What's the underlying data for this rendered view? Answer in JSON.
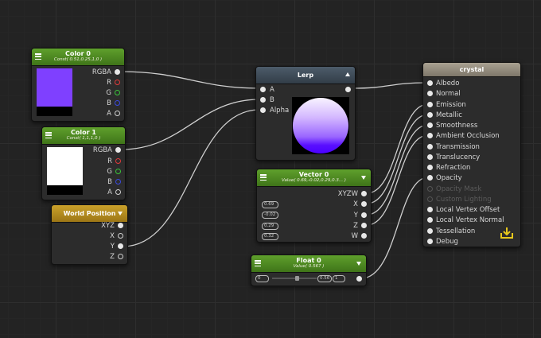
{
  "nodes": {
    "color0": {
      "title": "Color 0",
      "subtitle": "Const( 0.51,0.25,1,0 )",
      "swatch": "#7f40ff",
      "outputs": [
        "RGBA",
        "R",
        "G",
        "B",
        "A"
      ]
    },
    "color1": {
      "title": "Color 1",
      "subtitle": "Const( 1,1,1,0 )",
      "swatch": "#ffffff",
      "outputs": [
        "RGBA",
        "R",
        "G",
        "B",
        "A"
      ]
    },
    "world_position": {
      "title": "World Position",
      "outputs": [
        "XYZ",
        "X",
        "Y",
        "Z"
      ]
    },
    "lerp": {
      "title": "Lerp",
      "inputs": [
        "A",
        "B",
        "Alpha"
      ]
    },
    "vector0": {
      "title": "Vector 0",
      "subtitle": "Value( 0.69,-0.02,0.29,0.3... )",
      "outputs": [
        "XYZW",
        "X",
        "Y",
        "Z",
        "W"
      ],
      "fields": [
        "0.69",
        "-0.02",
        "0.29",
        "0.32"
      ]
    },
    "float0": {
      "title": "Float 0",
      "subtitle": "Value( 0.567 )",
      "min": "0",
      "value": "0.56",
      "max": "1",
      "slider_fraction": 0.567
    },
    "crystal": {
      "title": "crystal",
      "inputs": [
        {
          "label": "Albedo",
          "enabled": true
        },
        {
          "label": "Normal",
          "enabled": true
        },
        {
          "label": "Emission",
          "enabled": true
        },
        {
          "label": "Metallic",
          "enabled": true
        },
        {
          "label": "Smoothness",
          "enabled": true
        },
        {
          "label": "Ambient Occlusion",
          "enabled": true
        },
        {
          "label": "Transmission",
          "enabled": true
        },
        {
          "label": "Translucency",
          "enabled": true
        },
        {
          "label": "Refraction",
          "enabled": true
        },
        {
          "label": "Opacity",
          "enabled": true
        },
        {
          "label": "Opacity Mask",
          "enabled": false
        },
        {
          "label": "Custom Lighting",
          "enabled": false
        },
        {
          "label": "Local Vertex Offset",
          "enabled": true
        },
        {
          "label": "Local Vertex Normal",
          "enabled": true
        },
        {
          "label": "Tessellation",
          "enabled": true
        },
        {
          "label": "Debug",
          "enabled": true
        }
      ]
    }
  },
  "colors": {
    "wire": "#cfcfcf",
    "header_green": "#4f8a22",
    "header_yellow": "#b88d20",
    "header_blue": "#3e4b58",
    "header_output": "#948b7c",
    "save_icon": "#e8c81c"
  },
  "icons": {
    "menu": "hamburger-icon",
    "dropdown": "triangle-down-icon",
    "collapse": "triangle-up-icon",
    "save": "download-icon"
  }
}
